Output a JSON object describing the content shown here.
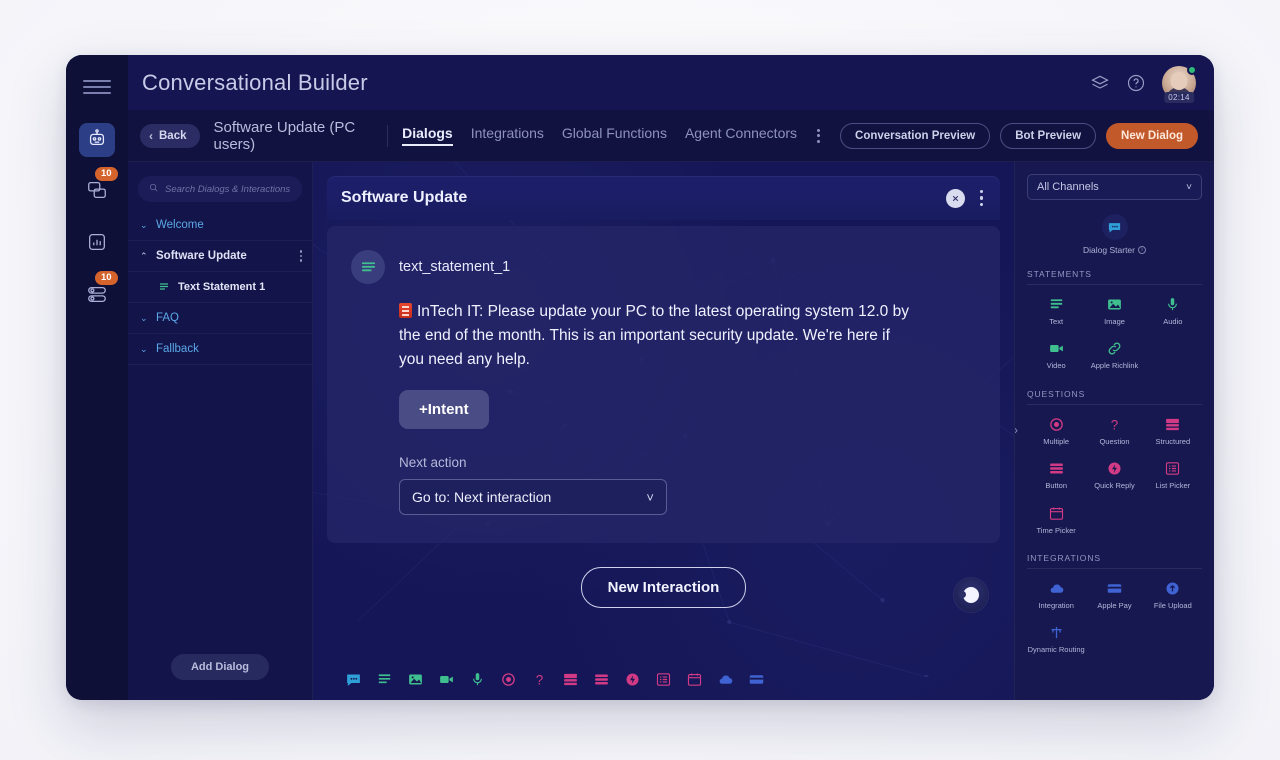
{
  "app": {
    "title": "Conversational Builder"
  },
  "rail": {
    "menu_icon": "hamburger-icon",
    "items": [
      {
        "name": "bot",
        "icon": "robot-icon",
        "badge": "",
        "active": true
      },
      {
        "name": "conversations",
        "icon": "chat-bubbles-icon",
        "badge": "10",
        "active": false
      },
      {
        "name": "analytics",
        "icon": "bar-chart-icon",
        "badge": "",
        "active": false
      },
      {
        "name": "routing",
        "icon": "toggles-icon",
        "badge": "10",
        "active": false
      }
    ]
  },
  "topbar": {
    "layers_icon": "layers-icon",
    "help_icon": "help-circle-icon",
    "avatar_timer": "02:14",
    "status": "online"
  },
  "subbar": {
    "back_label": "Back",
    "breadcrumb": "Software Update (PC users)",
    "tabs": [
      {
        "label": "Dialogs",
        "active": true
      },
      {
        "label": "Integrations",
        "active": false
      },
      {
        "label": "Global Functions",
        "active": false
      },
      {
        "label": "Agent Connectors",
        "active": false
      }
    ],
    "buttons": [
      {
        "label": "Conversation Preview",
        "primary": false
      },
      {
        "label": "Bot Preview",
        "primary": false
      },
      {
        "label": "New Dialog",
        "primary": true
      }
    ]
  },
  "dialog_list": {
    "search_placeholder": "Search Dialogs & Interactions",
    "items": [
      {
        "label": "Welcome",
        "state": "collapsed",
        "arrow": "⌄"
      },
      {
        "label": "Software Update",
        "state": "expanded",
        "arrow": "⌃",
        "kebab": true
      },
      {
        "label": "FAQ",
        "state": "collapsed",
        "arrow": "⌄"
      },
      {
        "label": "Fallback",
        "state": "collapsed",
        "arrow": "⌄"
      }
    ],
    "child": {
      "label": "Text Statement 1",
      "icon": "text-lines-icon"
    },
    "add_button": "Add Dialog"
  },
  "canvas": {
    "card_title": "Software Update",
    "statement_name": "text_statement_1",
    "statement_text": "InTech IT: Please update your PC to the latest operating system 12.0 by the end of the month. This is an important security update. We're here if you need any help.",
    "intent_button": "+Intent",
    "next_action_label": "Next action",
    "next_action_value": "Go to: Next interaction",
    "new_interaction_button": "New Interaction",
    "toolbar_icons": [
      "chat-bubble-icon",
      "text-lines-icon",
      "image-icon",
      "video-icon",
      "microphone-icon",
      "multiple-choice-icon",
      "question-mark-icon",
      "structured-icon",
      "button-icon",
      "quick-reply-icon",
      "list-picker-icon",
      "time-picker-icon",
      "cloud-icon",
      "apple-pay-icon"
    ]
  },
  "right_panel": {
    "channel_select": "All Channels",
    "dialog_starter": "Dialog Starter",
    "sections": [
      {
        "title": "STATEMENTS",
        "items": [
          {
            "label": "Text",
            "icon": "text-lines-icon",
            "color": "#3fbf8f"
          },
          {
            "label": "Image",
            "icon": "image-icon",
            "color": "#3fbf8f"
          },
          {
            "label": "Audio",
            "icon": "microphone-icon",
            "color": "#3fbf8f"
          },
          {
            "label": "Video",
            "icon": "video-icon",
            "color": "#3fbf8f"
          },
          {
            "label": "Apple Richlink",
            "icon": "link-icon",
            "color": "#3fbf8f"
          }
        ]
      },
      {
        "title": "QUESTIONS",
        "items": [
          {
            "label": "Multiple",
            "icon": "multiple-choice-icon",
            "color": "#d23a85"
          },
          {
            "label": "Question",
            "icon": "question-mark-icon",
            "color": "#d23a85"
          },
          {
            "label": "Structured",
            "icon": "structured-icon",
            "color": "#d23a85"
          },
          {
            "label": "Button",
            "icon": "button-icon",
            "color": "#d23a85"
          },
          {
            "label": "Quick Reply",
            "icon": "quick-reply-icon",
            "color": "#d23a85"
          },
          {
            "label": "List Picker",
            "icon": "list-picker-icon",
            "color": "#d23a85"
          },
          {
            "label": "Time Picker",
            "icon": "time-picker-icon",
            "color": "#d23a85"
          }
        ]
      },
      {
        "title": "INTEGRATIONS",
        "items": [
          {
            "label": "Integration",
            "icon": "cloud-icon",
            "color": "#3f63d2"
          },
          {
            "label": "Apple Pay",
            "icon": "apple-pay-icon",
            "color": "#3f63d2"
          },
          {
            "label": "File Upload",
            "icon": "file-upload-icon",
            "color": "#3f63d2"
          },
          {
            "label": "Dynamic Routing",
            "icon": "dynamic-routing-icon",
            "color": "#3f63d2"
          }
        ]
      }
    ]
  },
  "colors": {
    "accent_orange": "#c2592a",
    "link_blue": "#5ba8e8",
    "statement_green": "#3fbf8f",
    "question_pink": "#d23a85",
    "integration_blue": "#3f63d2",
    "window_bg": "#111240",
    "canvas_bg": "#151657"
  }
}
